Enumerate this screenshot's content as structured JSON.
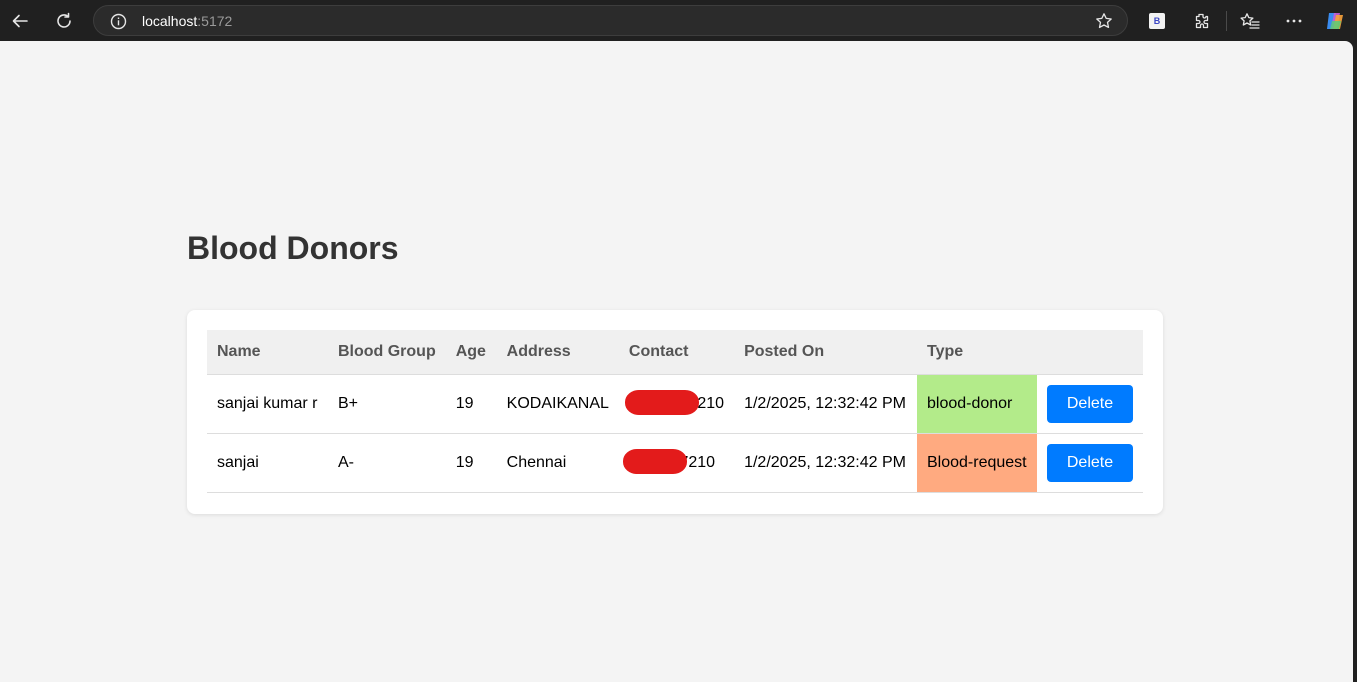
{
  "browser": {
    "url_host": "localhost",
    "url_port": ":5172",
    "extension_label": "B"
  },
  "page": {
    "title": "Blood Donors"
  },
  "table": {
    "headers": [
      "Name",
      "Blood Group",
      "Age",
      "Address",
      "Contact",
      "Posted On",
      "Type",
      ""
    ],
    "rows": [
      {
        "name": "sanjai kumar r",
        "blood_group": "B+",
        "age": "19",
        "address": "KODAIKANAL",
        "contact_visible": "7210",
        "posted_on": "1/2/2025, 12:32:42 PM",
        "type": "blood-donor",
        "action": "Delete"
      },
      {
        "name": "sanjai",
        "blood_group": "A-",
        "age": "19",
        "address": "Chennai",
        "contact_visible": "7210",
        "posted_on": "1/2/2025, 12:32:42 PM",
        "type": "Blood-request",
        "action": "Delete"
      }
    ]
  },
  "colors": {
    "donor_type_bg": "#b3eb8a",
    "request_type_bg": "#ffaa80",
    "delete_button_bg": "#007bff",
    "redaction": "#e31b1b"
  },
  "icons": [
    "back-arrow-icon",
    "reload-icon",
    "info-icon",
    "star-icon",
    "extensions-icon",
    "favorites-icon",
    "more-icon",
    "copilot-icon"
  ]
}
